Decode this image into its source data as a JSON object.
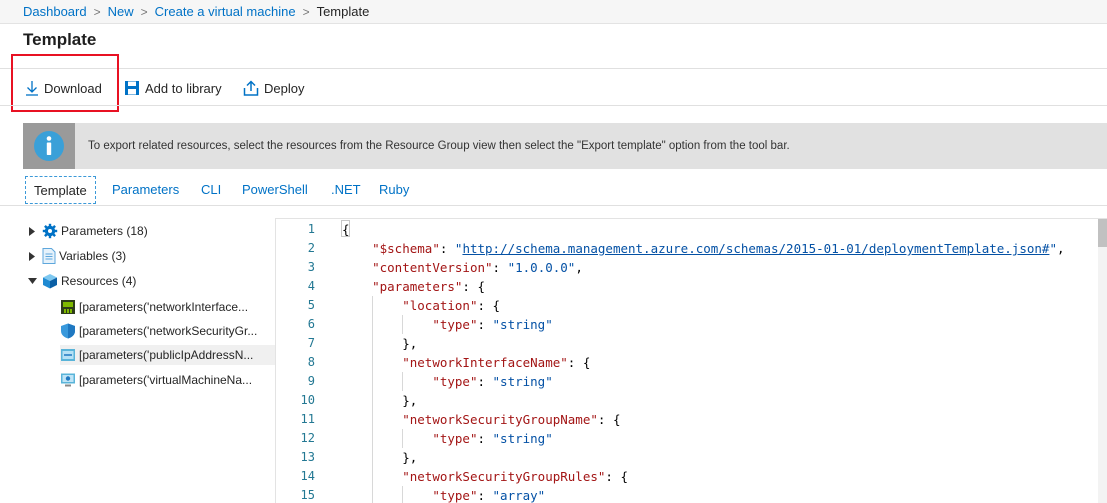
{
  "breadcrumb": {
    "items": [
      {
        "label": "Dashboard"
      },
      {
        "label": "New"
      },
      {
        "label": "Create a virtual machine"
      }
    ],
    "current": "Template",
    "separator": ">"
  },
  "page": {
    "title": "Template"
  },
  "toolbar": {
    "download_label": "Download",
    "add_to_library_label": "Add to library",
    "deploy_label": "Deploy"
  },
  "info_banner": {
    "icon": "info-icon",
    "text": "To export related resources, select the resources from the Resource Group view then select the \"Export template\" option from the tool bar."
  },
  "tabs": [
    {
      "label": "Template",
      "active": true
    },
    {
      "label": "Parameters"
    },
    {
      "label": "CLI"
    },
    {
      "label": "PowerShell"
    },
    {
      "label": ".NET"
    },
    {
      "label": "Ruby"
    }
  ],
  "tree": {
    "parameters": {
      "label": "Parameters (18)",
      "icon": "gear-icon",
      "expanded": false
    },
    "variables": {
      "label": "Variables (3)",
      "icon": "document-icon",
      "expanded": false
    },
    "resources": {
      "label": "Resources (4)",
      "icon": "cube-icon",
      "expanded": true
    },
    "resource_items": [
      {
        "label": "[parameters('networkInterface...",
        "icon": "network-interface-icon"
      },
      {
        "label": "[parameters('networkSecurityGr...",
        "icon": "shield-icon"
      },
      {
        "label": "[parameters('publicIpAddressN...",
        "icon": "public-ip-icon",
        "selected": true
      },
      {
        "label": "[parameters('virtualMachineNa...",
        "icon": "virtual-machine-icon"
      }
    ]
  },
  "editor": {
    "line_numbers": [
      "1",
      "2",
      "3",
      "4",
      "5",
      "6",
      "7",
      "8",
      "9",
      "10",
      "11",
      "12",
      "13",
      "14",
      "15"
    ],
    "lines": [
      {
        "indent": "",
        "parts": [
          {
            "t": "p",
            "v": "{"
          }
        ]
      },
      {
        "indent": "    ",
        "parts": [
          {
            "t": "k",
            "v": "\"$schema\""
          },
          {
            "t": "p",
            "v": ": "
          },
          {
            "t": "s",
            "v": "\""
          },
          {
            "t": "u",
            "v": "http://schema.management.azure.com/schemas/2015-01-01/deploymentTemplate.json#"
          },
          {
            "t": "s",
            "v": "\""
          },
          {
            "t": "p",
            "v": ","
          }
        ]
      },
      {
        "indent": "    ",
        "parts": [
          {
            "t": "k",
            "v": "\"contentVersion\""
          },
          {
            "t": "p",
            "v": ": "
          },
          {
            "t": "s",
            "v": "\"1.0.0.0\""
          },
          {
            "t": "p",
            "v": ","
          }
        ]
      },
      {
        "indent": "    ",
        "parts": [
          {
            "t": "k",
            "v": "\"parameters\""
          },
          {
            "t": "p",
            "v": ": {"
          }
        ]
      },
      {
        "indent": "        ",
        "parts": [
          {
            "t": "k",
            "v": "\"location\""
          },
          {
            "t": "p",
            "v": ": {"
          }
        ]
      },
      {
        "indent": "            ",
        "parts": [
          {
            "t": "k",
            "v": "\"type\""
          },
          {
            "t": "p",
            "v": ": "
          },
          {
            "t": "s",
            "v": "\"string\""
          }
        ]
      },
      {
        "indent": "        ",
        "parts": [
          {
            "t": "p",
            "v": "},"
          }
        ]
      },
      {
        "indent": "        ",
        "parts": [
          {
            "t": "k",
            "v": "\"networkInterfaceName\""
          },
          {
            "t": "p",
            "v": ": {"
          }
        ]
      },
      {
        "indent": "            ",
        "parts": [
          {
            "t": "k",
            "v": "\"type\""
          },
          {
            "t": "p",
            "v": ": "
          },
          {
            "t": "s",
            "v": "\"string\""
          }
        ]
      },
      {
        "indent": "        ",
        "parts": [
          {
            "t": "p",
            "v": "},"
          }
        ]
      },
      {
        "indent": "        ",
        "parts": [
          {
            "t": "k",
            "v": "\"networkSecurityGroupName\""
          },
          {
            "t": "p",
            "v": ": {"
          }
        ]
      },
      {
        "indent": "            ",
        "parts": [
          {
            "t": "k",
            "v": "\"type\""
          },
          {
            "t": "p",
            "v": ": "
          },
          {
            "t": "s",
            "v": "\"string\""
          }
        ]
      },
      {
        "indent": "        ",
        "parts": [
          {
            "t": "p",
            "v": "},"
          }
        ]
      },
      {
        "indent": "        ",
        "parts": [
          {
            "t": "k",
            "v": "\"networkSecurityGroupRules\""
          },
          {
            "t": "p",
            "v": ": {"
          }
        ]
      },
      {
        "indent": "            ",
        "parts": [
          {
            "t": "k",
            "v": "\"type\""
          },
          {
            "t": "p",
            "v": ": "
          },
          {
            "t": "s",
            "v": "\"array\""
          }
        ]
      }
    ]
  },
  "colors": {
    "link": "#0072c6",
    "highlight_border": "#e81123",
    "json_key": "#a31515",
    "json_string": "#0451a5",
    "line_number": "#237893"
  }
}
